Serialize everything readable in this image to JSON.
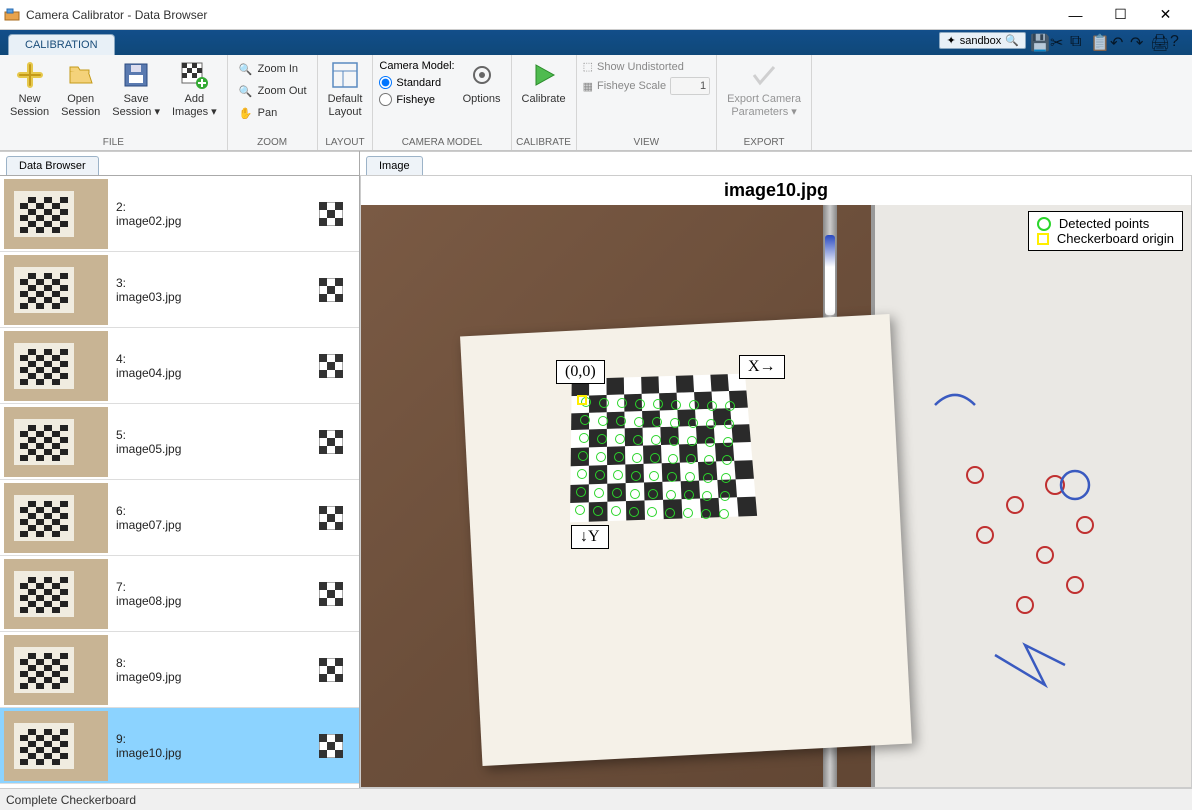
{
  "window": {
    "title": "Camera Calibrator - Data Browser"
  },
  "tabstrip": {
    "main_tab": "CALIBRATION",
    "sandbox": "sandbox"
  },
  "ribbon": {
    "file": {
      "new_session": "New\nSession",
      "open_session": "Open\nSession",
      "save_session": "Save\nSession ▾",
      "add_images": "Add\nImages ▾",
      "group": "FILE"
    },
    "zoom": {
      "zoom_in": "Zoom In",
      "zoom_out": "Zoom Out",
      "pan": "Pan",
      "group": "ZOOM"
    },
    "layout": {
      "default_layout": "Default\nLayout",
      "group": "LAYOUT"
    },
    "camera_model": {
      "label": "Camera Model:",
      "standard": "Standard",
      "fisheye": "Fisheye",
      "options": "Options",
      "group": "CAMERA MODEL"
    },
    "calibrate": {
      "calibrate": "Calibrate",
      "group": "CALIBRATE"
    },
    "view": {
      "show_undistorted": "Show Undistorted",
      "fisheye_scale": "Fisheye Scale",
      "scale_value": "1",
      "group": "VIEW"
    },
    "export": {
      "export": "Export Camera\nParameters ▾",
      "group": "EXPORT"
    }
  },
  "browser": {
    "tab": "Data Browser",
    "items": [
      {
        "idx": "2:",
        "name": "image02.jpg"
      },
      {
        "idx": "3:",
        "name": "image03.jpg"
      },
      {
        "idx": "4:",
        "name": "image04.jpg"
      },
      {
        "idx": "5:",
        "name": "image05.jpg"
      },
      {
        "idx": "6:",
        "name": "image07.jpg"
      },
      {
        "idx": "7:",
        "name": "image08.jpg"
      },
      {
        "idx": "8:",
        "name": "image09.jpg"
      },
      {
        "idx": "9:",
        "name": "image10.jpg"
      }
    ],
    "selected_index": 7
  },
  "image_panel": {
    "tab": "Image",
    "title": "image10.jpg",
    "legend": {
      "detected": "Detected points",
      "origin": "Checkerboard origin"
    },
    "ann": {
      "origin": "(0,0)",
      "x": "X→",
      "y": "↓Y"
    }
  },
  "status": {
    "text": "Complete Checkerboard"
  }
}
